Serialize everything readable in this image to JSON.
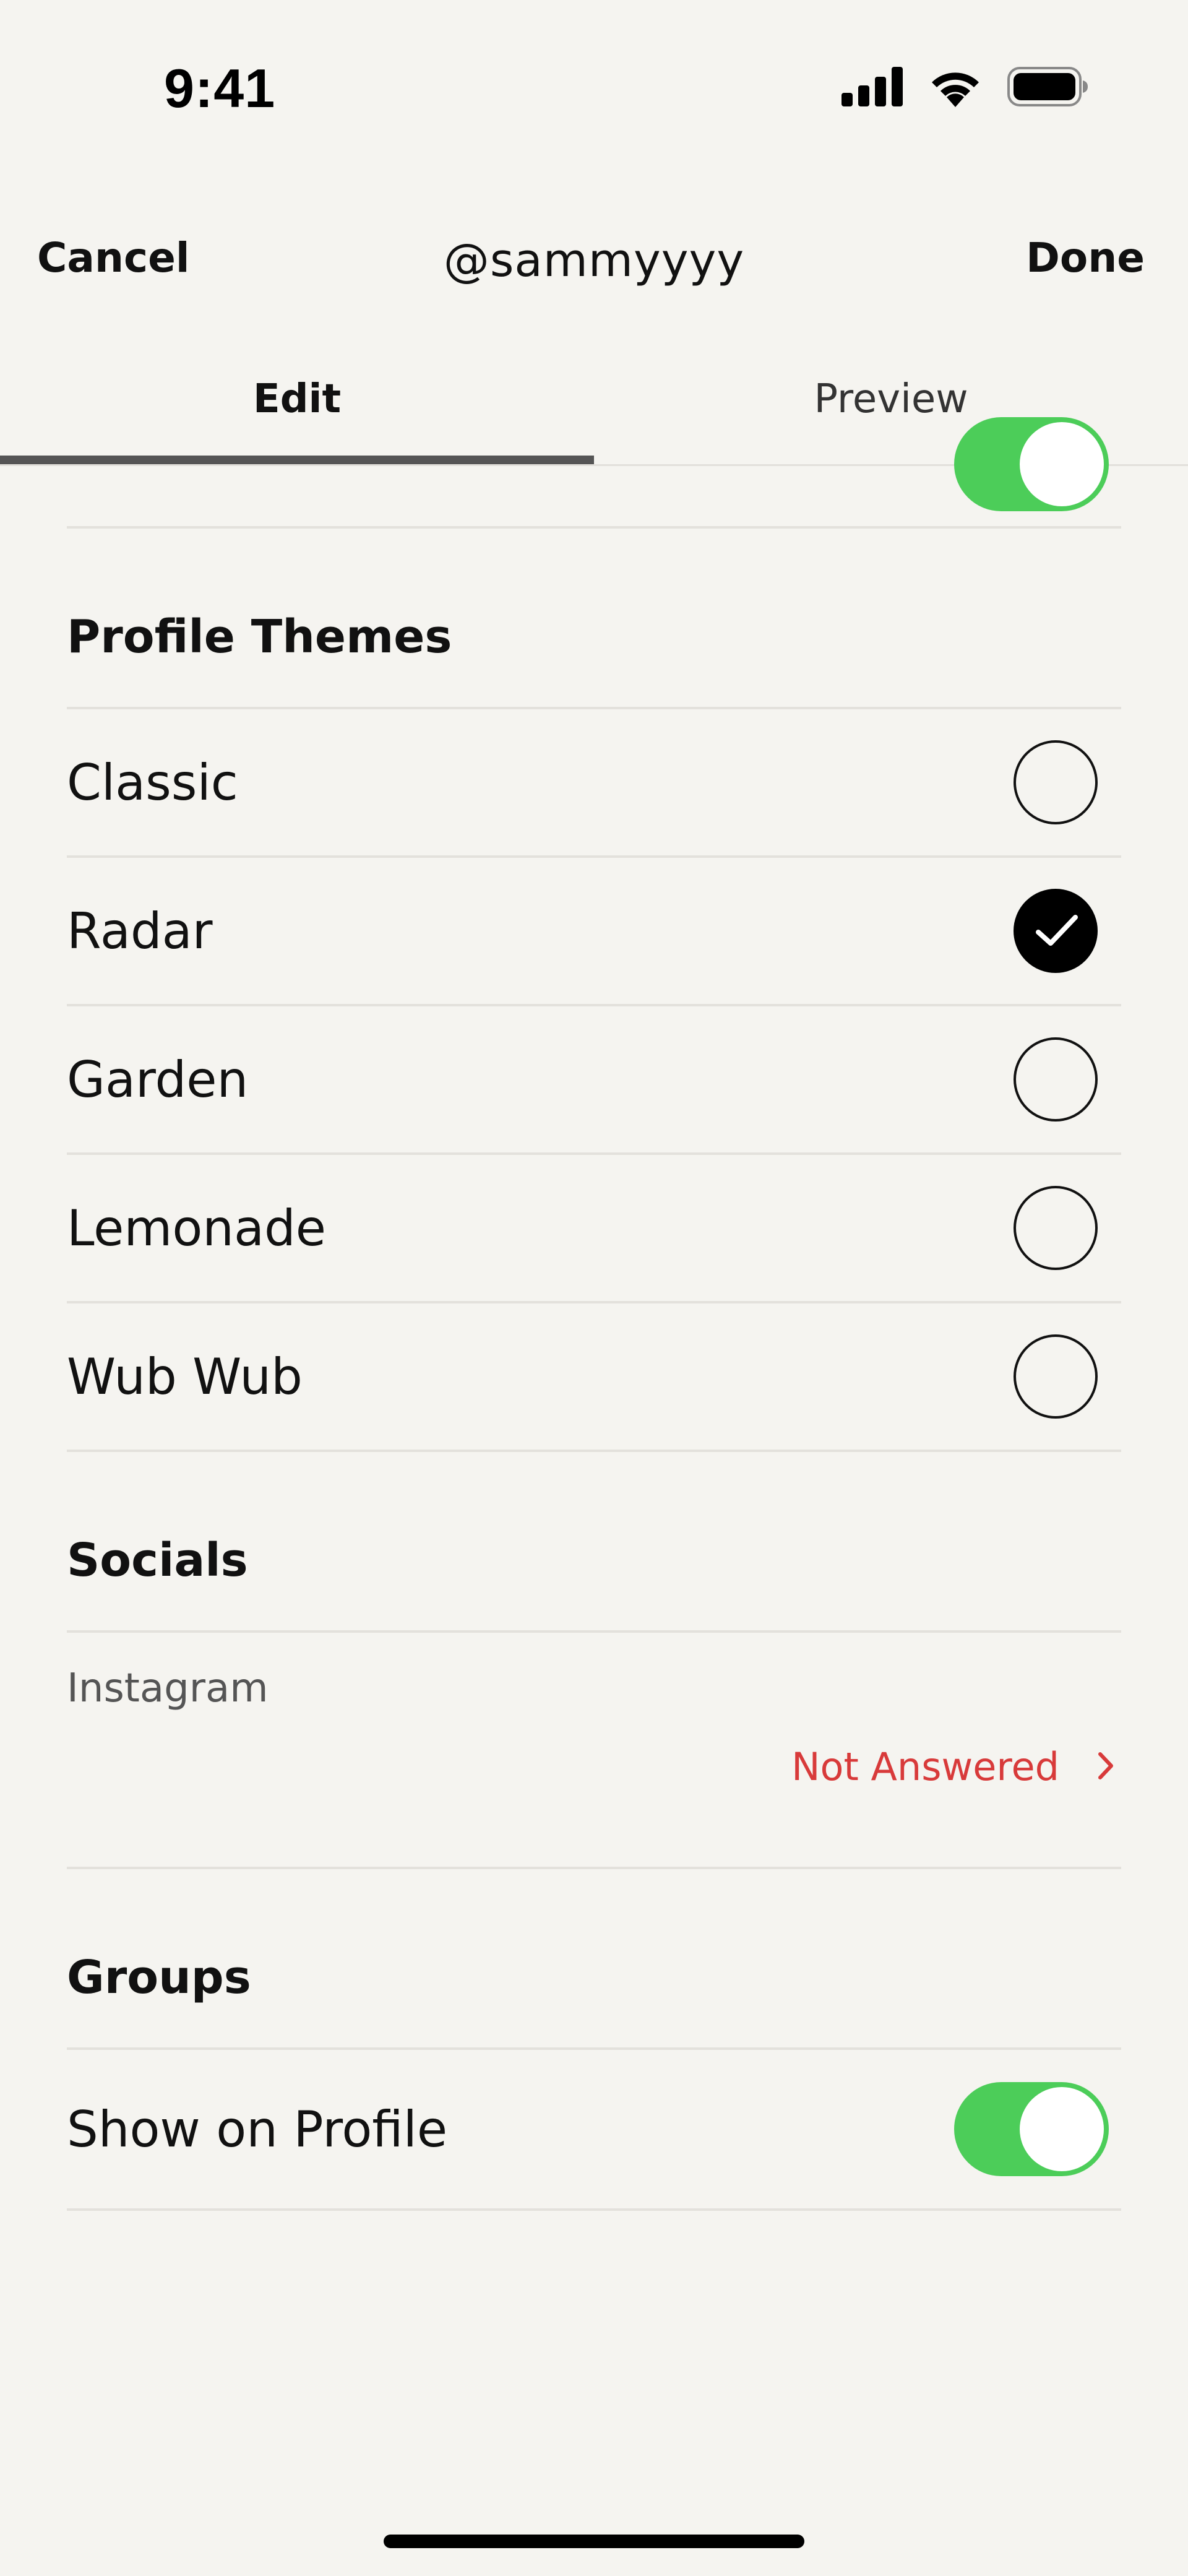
{
  "status_bar": {
    "time": "9:41",
    "icons": [
      "cellular-signal-icon",
      "wifi-icon",
      "battery-icon"
    ]
  },
  "nav": {
    "cancel_label": "Cancel",
    "title": "@sammyyyy",
    "done_label": "Done"
  },
  "tabs": [
    {
      "label": "Edit",
      "selected": true
    },
    {
      "label": "Preview",
      "selected": false
    }
  ],
  "profile_themes": {
    "header": "Profile Themes",
    "options": [
      {
        "label": "Classic",
        "selected": false
      },
      {
        "label": "Radar",
        "selected": true
      },
      {
        "label": "Garden",
        "selected": false
      },
      {
        "label": "Lemonade",
        "selected": false
      },
      {
        "label": "Wub Wub",
        "selected": false
      }
    ]
  },
  "socials": {
    "header": "Socials",
    "items": [
      {
        "label": "Instagram",
        "status": "Not Answered"
      }
    ]
  },
  "groups": {
    "header": "Groups",
    "show_on_profile_label": "Show on Profile",
    "show_on_profile": true
  },
  "colors": {
    "background": "#f5f4f0",
    "toggle_on": "#4ccd59",
    "not_answered": "#d83a3a",
    "tab_indicator": "#555555"
  }
}
